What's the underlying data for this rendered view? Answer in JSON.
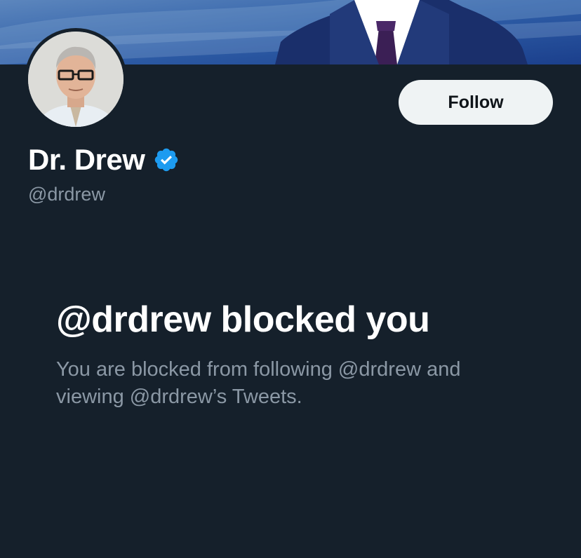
{
  "profile": {
    "display_name": "Dr. Drew",
    "handle": "@drdrew",
    "verified_icon": "verified-badge-icon",
    "follow_label": "Follow"
  },
  "blocked": {
    "title": "@drdrew blocked you",
    "message": "You are blocked from following @drdrew and viewing @drdrew’s Tweets."
  },
  "colors": {
    "background": "#15202b",
    "accent": "#1d9bf0",
    "secondary_text": "#8b98a5",
    "button_bg": "#eff3f4"
  }
}
